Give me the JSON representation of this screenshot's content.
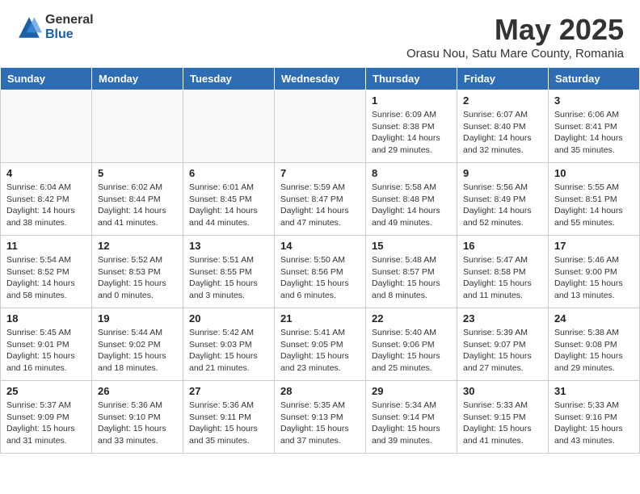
{
  "header": {
    "logo_general": "General",
    "logo_blue": "Blue",
    "month_title": "May 2025",
    "location": "Orasu Nou, Satu Mare County, Romania"
  },
  "days_of_week": [
    "Sunday",
    "Monday",
    "Tuesday",
    "Wednesday",
    "Thursday",
    "Friday",
    "Saturday"
  ],
  "weeks": [
    [
      {
        "day": "",
        "info": ""
      },
      {
        "day": "",
        "info": ""
      },
      {
        "day": "",
        "info": ""
      },
      {
        "day": "",
        "info": ""
      },
      {
        "day": "1",
        "info": "Sunrise: 6:09 AM\nSunset: 8:38 PM\nDaylight: 14 hours\nand 29 minutes."
      },
      {
        "day": "2",
        "info": "Sunrise: 6:07 AM\nSunset: 8:40 PM\nDaylight: 14 hours\nand 32 minutes."
      },
      {
        "day": "3",
        "info": "Sunrise: 6:06 AM\nSunset: 8:41 PM\nDaylight: 14 hours\nand 35 minutes."
      }
    ],
    [
      {
        "day": "4",
        "info": "Sunrise: 6:04 AM\nSunset: 8:42 PM\nDaylight: 14 hours\nand 38 minutes."
      },
      {
        "day": "5",
        "info": "Sunrise: 6:02 AM\nSunset: 8:44 PM\nDaylight: 14 hours\nand 41 minutes."
      },
      {
        "day": "6",
        "info": "Sunrise: 6:01 AM\nSunset: 8:45 PM\nDaylight: 14 hours\nand 44 minutes."
      },
      {
        "day": "7",
        "info": "Sunrise: 5:59 AM\nSunset: 8:47 PM\nDaylight: 14 hours\nand 47 minutes."
      },
      {
        "day": "8",
        "info": "Sunrise: 5:58 AM\nSunset: 8:48 PM\nDaylight: 14 hours\nand 49 minutes."
      },
      {
        "day": "9",
        "info": "Sunrise: 5:56 AM\nSunset: 8:49 PM\nDaylight: 14 hours\nand 52 minutes."
      },
      {
        "day": "10",
        "info": "Sunrise: 5:55 AM\nSunset: 8:51 PM\nDaylight: 14 hours\nand 55 minutes."
      }
    ],
    [
      {
        "day": "11",
        "info": "Sunrise: 5:54 AM\nSunset: 8:52 PM\nDaylight: 14 hours\nand 58 minutes."
      },
      {
        "day": "12",
        "info": "Sunrise: 5:52 AM\nSunset: 8:53 PM\nDaylight: 15 hours\nand 0 minutes."
      },
      {
        "day": "13",
        "info": "Sunrise: 5:51 AM\nSunset: 8:55 PM\nDaylight: 15 hours\nand 3 minutes."
      },
      {
        "day": "14",
        "info": "Sunrise: 5:50 AM\nSunset: 8:56 PM\nDaylight: 15 hours\nand 6 minutes."
      },
      {
        "day": "15",
        "info": "Sunrise: 5:48 AM\nSunset: 8:57 PM\nDaylight: 15 hours\nand 8 minutes."
      },
      {
        "day": "16",
        "info": "Sunrise: 5:47 AM\nSunset: 8:58 PM\nDaylight: 15 hours\nand 11 minutes."
      },
      {
        "day": "17",
        "info": "Sunrise: 5:46 AM\nSunset: 9:00 PM\nDaylight: 15 hours\nand 13 minutes."
      }
    ],
    [
      {
        "day": "18",
        "info": "Sunrise: 5:45 AM\nSunset: 9:01 PM\nDaylight: 15 hours\nand 16 minutes."
      },
      {
        "day": "19",
        "info": "Sunrise: 5:44 AM\nSunset: 9:02 PM\nDaylight: 15 hours\nand 18 minutes."
      },
      {
        "day": "20",
        "info": "Sunrise: 5:42 AM\nSunset: 9:03 PM\nDaylight: 15 hours\nand 21 minutes."
      },
      {
        "day": "21",
        "info": "Sunrise: 5:41 AM\nSunset: 9:05 PM\nDaylight: 15 hours\nand 23 minutes."
      },
      {
        "day": "22",
        "info": "Sunrise: 5:40 AM\nSunset: 9:06 PM\nDaylight: 15 hours\nand 25 minutes."
      },
      {
        "day": "23",
        "info": "Sunrise: 5:39 AM\nSunset: 9:07 PM\nDaylight: 15 hours\nand 27 minutes."
      },
      {
        "day": "24",
        "info": "Sunrise: 5:38 AM\nSunset: 9:08 PM\nDaylight: 15 hours\nand 29 minutes."
      }
    ],
    [
      {
        "day": "25",
        "info": "Sunrise: 5:37 AM\nSunset: 9:09 PM\nDaylight: 15 hours\nand 31 minutes."
      },
      {
        "day": "26",
        "info": "Sunrise: 5:36 AM\nSunset: 9:10 PM\nDaylight: 15 hours\nand 33 minutes."
      },
      {
        "day": "27",
        "info": "Sunrise: 5:36 AM\nSunset: 9:11 PM\nDaylight: 15 hours\nand 35 minutes."
      },
      {
        "day": "28",
        "info": "Sunrise: 5:35 AM\nSunset: 9:13 PM\nDaylight: 15 hours\nand 37 minutes."
      },
      {
        "day": "29",
        "info": "Sunrise: 5:34 AM\nSunset: 9:14 PM\nDaylight: 15 hours\nand 39 minutes."
      },
      {
        "day": "30",
        "info": "Sunrise: 5:33 AM\nSunset: 9:15 PM\nDaylight: 15 hours\nand 41 minutes."
      },
      {
        "day": "31",
        "info": "Sunrise: 5:33 AM\nSunset: 9:16 PM\nDaylight: 15 hours\nand 43 minutes."
      }
    ]
  ]
}
